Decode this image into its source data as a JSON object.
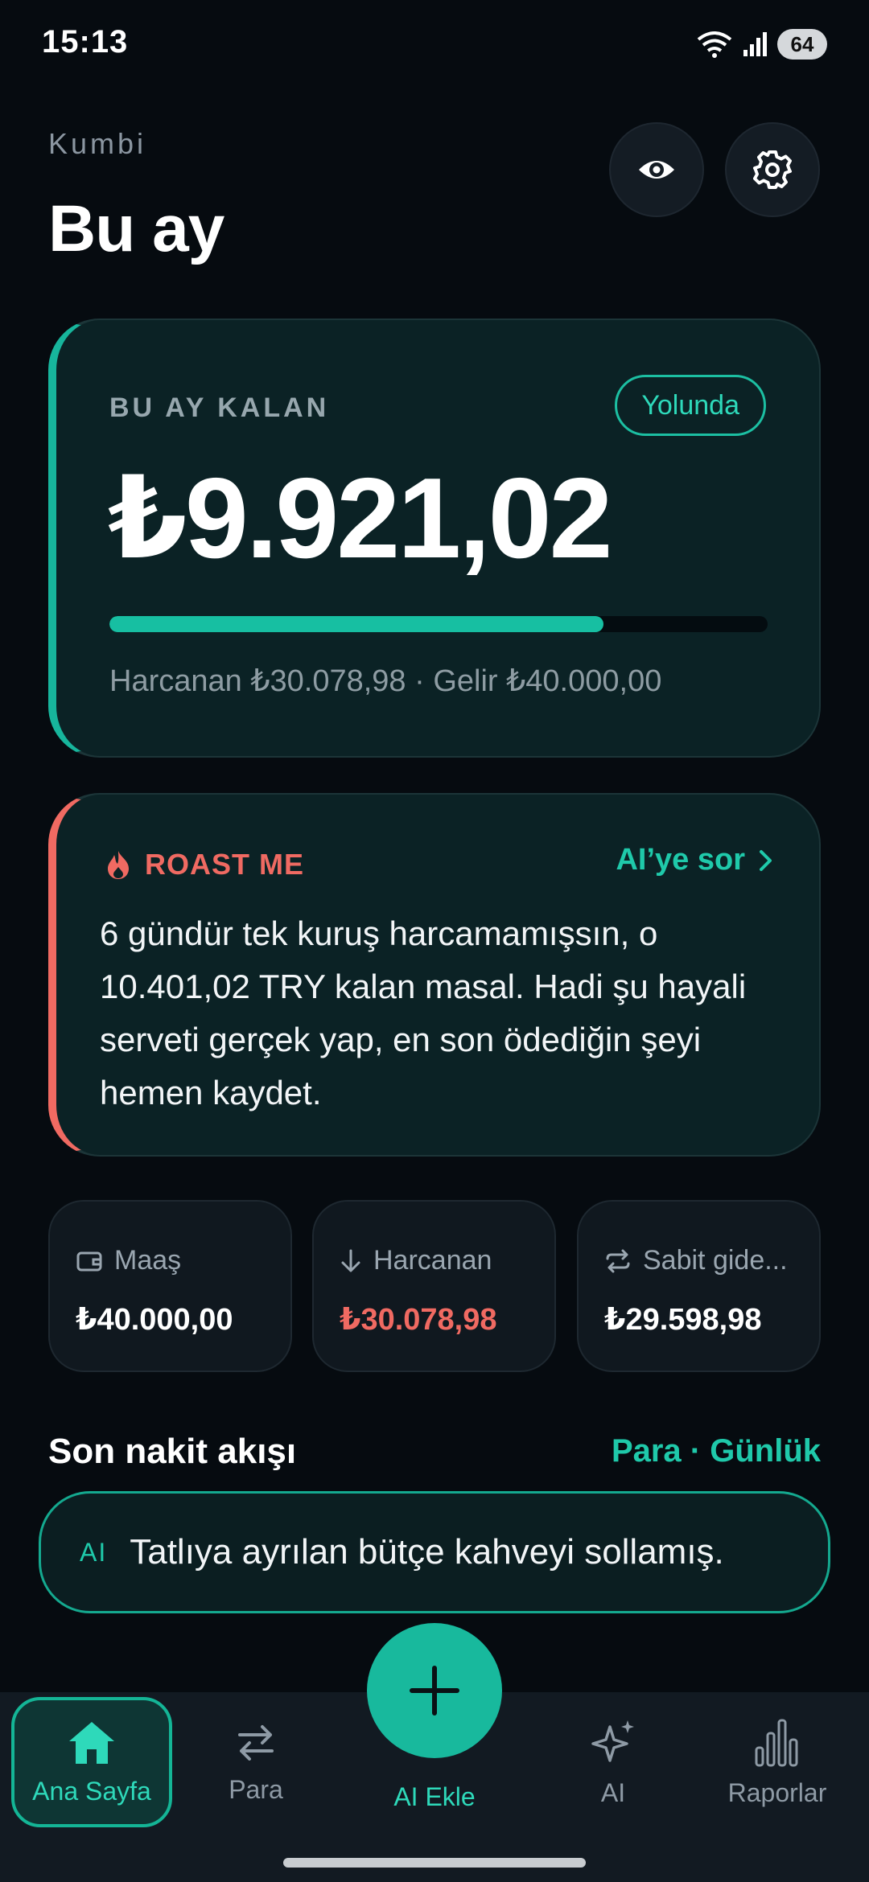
{
  "status_bar": {
    "time": "15:13",
    "battery": "64"
  },
  "header": {
    "app_name": "Kumbi",
    "title": "Bu ay"
  },
  "balance_card": {
    "label": "BU AY KALAN",
    "status_badge": "Yolunda",
    "amount": "₺9.921,02",
    "progress_fraction": 0.75,
    "summary": "Harcanan ₺30.078,98 · Gelir ₺40.000,00"
  },
  "roast_card": {
    "title": "ROAST ME",
    "ask_ai_label": "AI’ye sor",
    "text": "6 gündür tek kuruş harcamamışsın, o 10.401,02 TRY kalan masal. Hadi şu hayali serveti gerçek yap, en son ödediğin şeyi hemen kaydet."
  },
  "stats": [
    {
      "label": "Maaş",
      "value": "₺40.000,00",
      "icon": "wallet-icon"
    },
    {
      "label": "Harcanan",
      "value": "₺30.078,98",
      "icon": "arrow-down-icon"
    },
    {
      "label": "Sabit gide...",
      "value": "₺29.598,98",
      "icon": "repeat-icon"
    }
  ],
  "cashflow": {
    "title": "Son nakit akışı",
    "link": "Para · Günlük",
    "insight_tag": "AI",
    "insight_text": "Tatlıya ayrılan bütçe kahveyi sollamış."
  },
  "nav": {
    "home": "Ana Sayfa",
    "money": "Para",
    "add": "AI Ekle",
    "ai": "AI",
    "reports": "Raporlar"
  },
  "colors": {
    "accent": "#17B59C",
    "danger": "#F06A62",
    "background": "#060B10"
  }
}
